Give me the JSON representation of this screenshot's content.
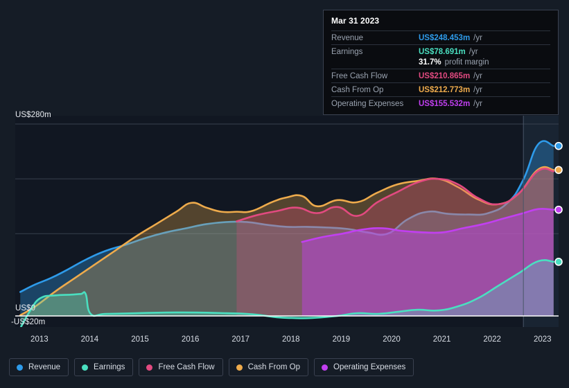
{
  "tooltip": {
    "date": "Mar 31 2023",
    "rows": [
      {
        "label": "Revenue",
        "value": "US$248.453m",
        "unit": "/yr",
        "color": "#2e9bea"
      },
      {
        "label": "Earnings",
        "value": "US$78.691m",
        "unit": "/yr",
        "color": "#4adfc0"
      },
      {
        "label": "Free Cash Flow",
        "value": "US$210.865m",
        "unit": "/yr",
        "color": "#e24a80"
      },
      {
        "label": "Cash From Op",
        "value": "US$212.773m",
        "unit": "/yr",
        "color": "#eeab4c"
      },
      {
        "label": "Operating Expenses",
        "value": "US$155.532m",
        "unit": "/yr",
        "color": "#c13ff0"
      }
    ],
    "margin_value": "31.7%",
    "margin_text": "profit margin"
  },
  "axes": {
    "y_top": "US$280m",
    "y_zero": "US$0",
    "y_bottom": "-US$20m",
    "x_ticks": [
      "2013",
      "2014",
      "2015",
      "2016",
      "2017",
      "2018",
      "2019",
      "2020",
      "2021",
      "2022",
      "2023"
    ]
  },
  "legend": [
    {
      "label": "Revenue",
      "color": "#2e9bea"
    },
    {
      "label": "Earnings",
      "color": "#4adfc0"
    },
    {
      "label": "Free Cash Flow",
      "color": "#e24a80"
    },
    {
      "label": "Cash From Op",
      "color": "#eeab4c"
    },
    {
      "label": "Operating Expenses",
      "color": "#c13ff0"
    }
  ],
  "chart_data": {
    "type": "area",
    "title": "",
    "xlabel": "",
    "ylabel": "",
    "ylim": [
      -20,
      280
    ],
    "xlim": [
      2012.6,
      2023.4
    ],
    "grid": true,
    "legend_position": "bottom",
    "gridlines": [
      280,
      200,
      120,
      0
    ],
    "currency": "US$ millions",
    "forecast_start": 2022.7,
    "series": [
      {
        "name": "Revenue",
        "color": "#2e9bea",
        "x": [
          2012.7,
          2013.0,
          2013.3,
          2013.6,
          2014.0,
          2014.4,
          2014.8,
          2015.2,
          2015.6,
          2016.0,
          2016.4,
          2016.8,
          2017.2,
          2017.6,
          2018.0,
          2018.4,
          2018.8,
          2019.2,
          2019.6,
          2020.0,
          2020.4,
          2020.8,
          2021.2,
          2021.6,
          2022.0,
          2022.4,
          2022.7,
          2023.0,
          2023.3
        ],
        "values": [
          35,
          46,
          55,
          66,
          82,
          95,
          104,
          114,
          122,
          128,
          134,
          137,
          137,
          133,
          130,
          130,
          129,
          127,
          122,
          120,
          141,
          152,
          149,
          148,
          150,
          166,
          199,
          251,
          248
        ]
      },
      {
        "name": "Earnings",
        "color": "#4adfc0",
        "x": [
          2012.7,
          2012.9,
          2013.1,
          2013.4,
          2013.7,
          2013.9,
          2014.0,
          2014.1,
          2014.4,
          2015.0,
          2015.6,
          2016.2,
          2016.8,
          2017.2,
          2017.5,
          2017.8,
          2018.1,
          2018.5,
          2019.0,
          2019.4,
          2019.8,
          2020.2,
          2020.6,
          2021.0,
          2021.4,
          2021.8,
          2022.2,
          2022.6,
          2023.0,
          2023.3
        ],
        "values": [
          -18,
          8,
          26,
          30,
          31,
          32,
          32,
          3,
          3,
          4,
          5,
          5,
          4,
          3,
          1,
          -2,
          -3,
          -3,
          0,
          4,
          3,
          6,
          9,
          8,
          14,
          26,
          44,
          62,
          80,
          79
        ]
      },
      {
        "name": "Free Cash Flow",
        "color": "#e24a80",
        "x": [
          2017.0,
          2017.4,
          2017.8,
          2018.2,
          2018.6,
          2019.0,
          2019.4,
          2019.8,
          2020.2,
          2020.6,
          2021.0,
          2021.4,
          2021.8,
          2022.2,
          2022.6,
          2023.0,
          2023.3
        ],
        "values": [
          138,
          147,
          153,
          158,
          150,
          159,
          146,
          166,
          181,
          195,
          200,
          192,
          172,
          163,
          178,
          212,
          211
        ]
      },
      {
        "name": "Cash From Op",
        "color": "#eeab4c",
        "x": [
          2012.7,
          2013.0,
          2013.4,
          2013.8,
          2014.2,
          2014.6,
          2015.0,
          2015.4,
          2015.8,
          2016.1,
          2016.4,
          2016.7,
          2017.0,
          2017.3,
          2017.7,
          2018.0,
          2018.3,
          2018.6,
          2019.0,
          2019.4,
          2019.8,
          2020.2,
          2020.6,
          2021.0,
          2021.4,
          2021.8,
          2022.2,
          2022.6,
          2023.0,
          2023.3
        ],
        "values": [
          1,
          14,
          36,
          56,
          76,
          96,
          116,
          134,
          152,
          165,
          158,
          152,
          152,
          153,
          166,
          173,
          175,
          160,
          169,
          166,
          180,
          192,
          197,
          200,
          188,
          170,
          163,
          178,
          214,
          213
        ]
      },
      {
        "name": "Operating Expenses",
        "color": "#c13ff0",
        "x": [
          2018.3,
          2018.7,
          2019.1,
          2019.5,
          2019.9,
          2020.3,
          2020.7,
          2021.1,
          2021.5,
          2021.9,
          2022.3,
          2022.7,
          2023.0,
          2023.3
        ],
        "values": [
          108,
          115,
          120,
          126,
          128,
          124,
          122,
          122,
          128,
          134,
          142,
          150,
          156,
          155
        ]
      }
    ]
  }
}
